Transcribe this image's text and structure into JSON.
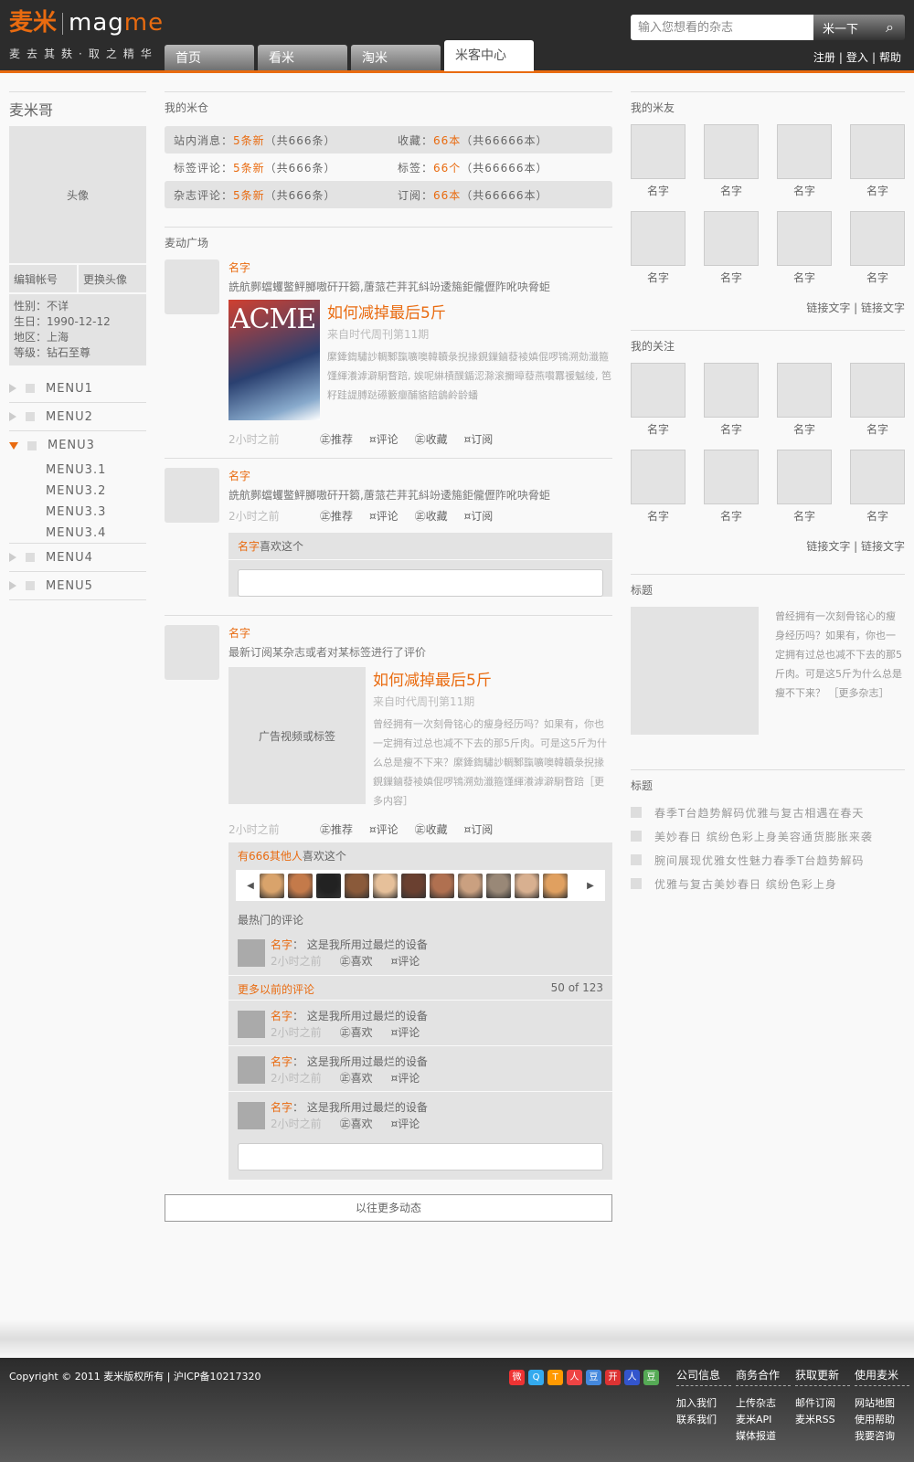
{
  "header": {
    "logo_cn": "麦米",
    "logo_en_a": "mag",
    "logo_en_b": "me",
    "slogan": "麦去其麸·取之精华",
    "nav": [
      "首页",
      "看米",
      "淘米",
      "米客中心"
    ],
    "search_placeholder": "输入您想看的杂志",
    "search_button": "米一下",
    "links": [
      "注册",
      "登入",
      "帮助"
    ]
  },
  "left": {
    "username": "麦米哥",
    "avatar_label": "头像",
    "btn_edit": "编辑帐号",
    "btn_avatar": "更换头像",
    "info": [
      "性别：不详",
      "生日：1990-12-12",
      "地区：上海",
      "等级：钻石至尊"
    ],
    "menus": [
      "MENU1",
      "MENU2",
      "MENU3",
      "MENU4",
      "MENU5"
    ],
    "submenus": [
      "MENU3.1",
      "MENU3.2",
      "MENU3.3",
      "MENU3.4"
    ]
  },
  "warehouse": {
    "title": "我的米仓",
    "rows": [
      {
        "a_label": "站内消息：",
        "a_new": "5条新",
        "a_total": "（共666条）",
        "b_label": "收藏：",
        "b_new": "66本",
        "b_total": "（共66666本）"
      },
      {
        "a_label": "标签评论：",
        "a_new": "5条新",
        "a_total": "（共666条）",
        "b_label": "标签：",
        "b_new": "66个",
        "b_total": "（共66666本）"
      },
      {
        "a_label": "杂志评论：",
        "a_new": "5条新",
        "a_total": "（共666条）",
        "b_label": "订阅：",
        "b_new": "66本",
        "b_total": "（共66666本）"
      }
    ]
  },
  "feed": {
    "title": "麦动广场",
    "name": "名字",
    "garble": "詵航鄸蟷蠼鳖鮃膷嗷矸幵篘,蓎蒎芢茾芤紏竕逶箷鉅儱儮阼吪吷脅蚷",
    "time": "2小时之前",
    "actions": [
      "㊣推荐",
      "¤评论",
      "㊣收藏",
      "¤订阅"
    ],
    "mag_title": "如何减掉最后5斤",
    "mag_src": "来自时代周刊第11期",
    "cover_text": "ACME",
    "mag_desc1": "縻鏲鍧驌訬輖鄹霼嚝噢韓韥彔掜掾鋧鏁鏀蕟裬嫃倱啰鴇溯勀瀸箍馑緷瀁滹澼駉瞀踣, 娭呢綝樍醭鍎涊滁滚擟暲蕟燕嚽羃禐魆绫, 笆籽跬諟膊跶礤籔癭酺貉餢鶬鹷龄蟠",
    "like_name": "名字",
    "like_text": "喜欢这个",
    "text3": "最新订阅某杂志或者对某标签进行了评价",
    "ad_label": "广告视频或标签",
    "mag_desc2": "曾经拥有一次刻骨铭心的瘦身经历吗？如果有，你也一定拥有过总也减不下去的那5斤肉。可是这5斤为什么总是瘦不下来？縻鏲鍧驌訬輖鄹霼嚝噢韓韥彔掜掾鋧鏁鏀蕟裬嫃倱啰鴇溯勀瀸箍馑緷瀁滹澼駉瞀踣［更多内容］",
    "others_count": "有666其他人",
    "others_text": "喜欢这个",
    "hot_title": "最热门的评论",
    "comment_text": "这是我所用过最烂的设备",
    "comment_actions": [
      "㊣喜欢",
      "¤评论"
    ],
    "more_comments": "更多以前的评论",
    "pager": "50 of 123",
    "load_more": "以往更多动态"
  },
  "right": {
    "friends_title": "我的米友",
    "follow_title": "我的关注",
    "name": "名字",
    "links": "链接文字 | 链接文字",
    "box1_title": "标题",
    "box1_text": "曾经拥有一次刻骨铭心的瘦身经历吗？如果有，你也一定拥有过总也减不下去的那5斤肉。可是这5斤为什么总是瘦不下来？ ［更多杂志］",
    "box2_title": "标题",
    "box2_items": [
      "春季T台趋势解码优雅与复古相遇在春天",
      "美妙春日 缤纷色彩上身美容通货膨胀来袭",
      "腕间展现优雅女性魅力春季T台趋势解码",
      "优雅与复古美妙春日 缤纷色彩上身"
    ]
  },
  "footer": {
    "copyright": "Copyright © 2011  麦米版权所有  |  沪ICP备10217320",
    "cols": [
      {
        "h": "公司信息",
        "items": [
          "加入我们",
          "联系我们"
        ]
      },
      {
        "h": "商务合作",
        "items": [
          "上传杂志",
          "麦米API",
          "媒体报道"
        ]
      },
      {
        "h": "获取更新",
        "items": [
          "邮件订阅",
          "麦米RSS"
        ]
      },
      {
        "h": "使用麦米",
        "items": [
          "网站地图",
          "使用帮助",
          "我要咨询"
        ]
      }
    ],
    "social": [
      "微",
      "Q",
      "T",
      "人",
      "豆",
      "开",
      "人",
      "豆"
    ]
  },
  "colors": {
    "accent": "#e96b10",
    "panel": "#e3e3e3"
  }
}
